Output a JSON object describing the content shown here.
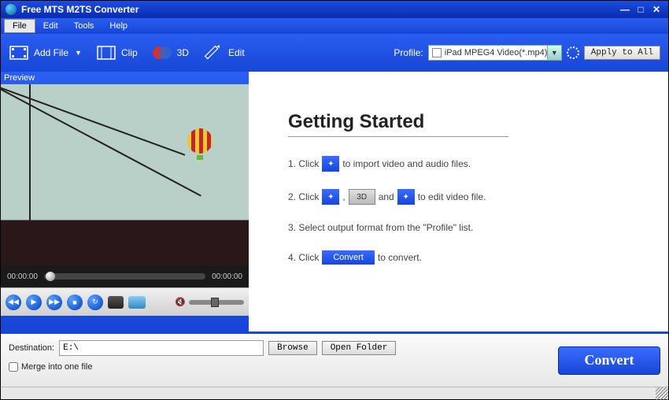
{
  "title": "Free MTS M2TS Converter",
  "menu": {
    "file": "File",
    "edit": "Edit",
    "tools": "Tools",
    "help": "Help"
  },
  "toolbar": {
    "add_file": "Add File",
    "clip": "Clip",
    "three_d": "3D",
    "edit": "Edit",
    "profile_label": "Profile:",
    "profile_value": "iPad MPEG4 Video(*.mp4)",
    "apply_all": "Apply to All"
  },
  "preview": {
    "label": "Preview",
    "time_start": "00:00:00",
    "time_end": "00:00:00"
  },
  "getting_started": {
    "heading": "Getting Started",
    "s1a": "1. Click",
    "s1b": "to import video and audio files.",
    "s2a": "2. Click",
    "s2b": ",",
    "s2c": "and",
    "s2d": "to edit video file.",
    "s2_3d": "3D",
    "s3": "3. Select output format from the \"Profile\" list.",
    "s4a": "4. Click",
    "s4_btn": "Convert",
    "s4b": "to convert."
  },
  "footer": {
    "dest_label": "Destination:",
    "dest_value": "E:\\",
    "browse": "Browse",
    "open_folder": "Open Folder",
    "merge": "Merge into one file",
    "convert": "Convert"
  }
}
